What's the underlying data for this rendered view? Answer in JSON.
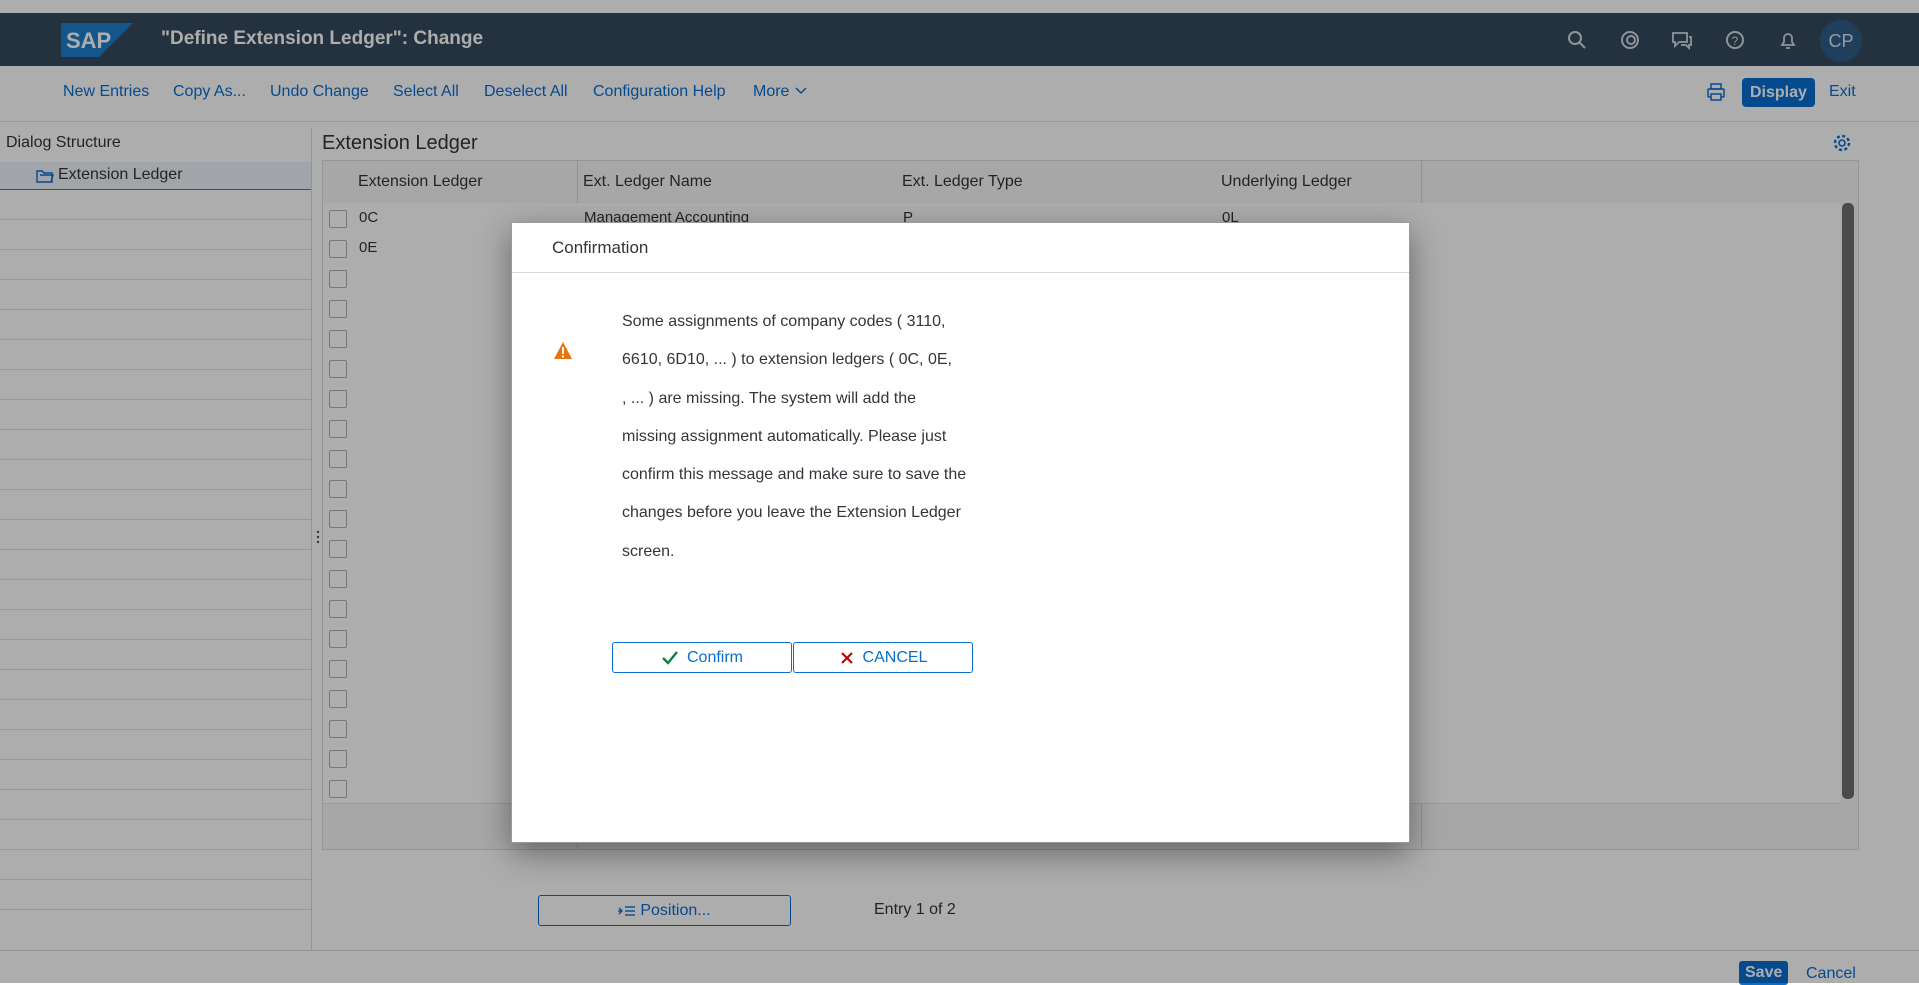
{
  "shell": {
    "logo_text": "SAP",
    "title": "\"Define Extension Ledger\": Change",
    "avatar_initials": "CP"
  },
  "toolbar": {
    "items": [
      "New Entries",
      "Copy As...",
      "Undo Change",
      "Select All",
      "Deselect All",
      "Configuration Help",
      "More"
    ],
    "display_label": "Display",
    "exit_label": "Exit"
  },
  "left_panel": {
    "title": "Dialog Structure",
    "tree_item": "Extension Ledger"
  },
  "main": {
    "title": "Extension Ledger",
    "columns": [
      "Extension Ledger",
      "Ext. Ledger Name",
      "Ext. Ledger Type",
      "Underlying Ledger"
    ],
    "rows": [
      {
        "ledger": "0C",
        "name": "Management Accounting",
        "type": "P",
        "underlying": "0L"
      },
      {
        "ledger": "0E",
        "name": "",
        "type": "",
        "underlying": ""
      }
    ],
    "position_button": "Position...",
    "entry_info": "Entry 1 of 2"
  },
  "footer": {
    "save_label": "Save",
    "cancel_label": "Cancel"
  },
  "dialog": {
    "title": "Confirmation",
    "message_lines": [
      "Some assignments of company codes ( 3110,",
      "6610, 6D10, ... ) to extension ledgers ( 0C, 0E,",
      ", ... ) are missing. The system will add the",
      "missing assignment automatically. Please just",
      "confirm this message and make sure to save the",
      "changes before you leave the Extension Ledger",
      "screen."
    ],
    "confirm_label": "Confirm",
    "cancel_label": "CANCEL"
  },
  "colors": {
    "shell_bg": "#354a5f",
    "accent": "#0a6ed1",
    "warning": "#e9730c",
    "reject": "#bb0000",
    "accept": "#107e3e"
  }
}
